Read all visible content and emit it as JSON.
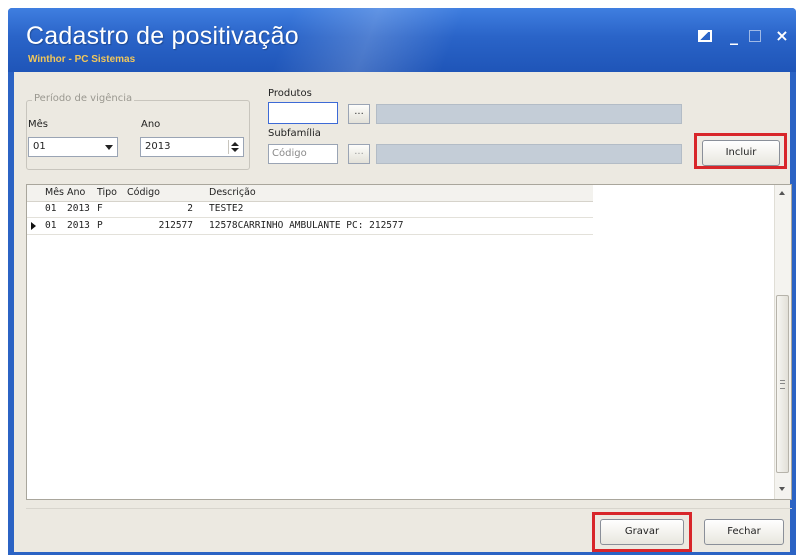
{
  "window": {
    "title": "Cadastro de positivação",
    "subtitle": "Winthor - PC Sistemas",
    "controls": {
      "minimize": "_",
      "close": "×"
    }
  },
  "periodo": {
    "legend": "Período de vigência",
    "mes_label": "Mês",
    "mes_value": "01",
    "ano_label": "Ano",
    "ano_value": "2013"
  },
  "produtos": {
    "label": "Produtos",
    "code_value": "",
    "lookup_label": "...",
    "description": ""
  },
  "subfamilia": {
    "label": "Subfamília",
    "code_placeholder": "Código",
    "lookup_label": "...",
    "description": ""
  },
  "buttons": {
    "incluir": "Incluir",
    "gravar": "Gravar",
    "fechar": "Fechar"
  },
  "highlight_color": "#d8262a",
  "grid": {
    "columns": [
      "Mês",
      "Ano",
      "Tipo",
      "Código",
      "Descrição"
    ],
    "rows": [
      {
        "mes": "01",
        "ano": "2013",
        "tipo": "F",
        "codigo": "2",
        "descricao": "TESTE2",
        "current": false
      },
      {
        "mes": "01",
        "ano": "2013",
        "tipo": "P",
        "codigo": "212577",
        "descricao": "12578CARRINHO AMBULANTE  PC: 212577",
        "current": true
      }
    ]
  }
}
